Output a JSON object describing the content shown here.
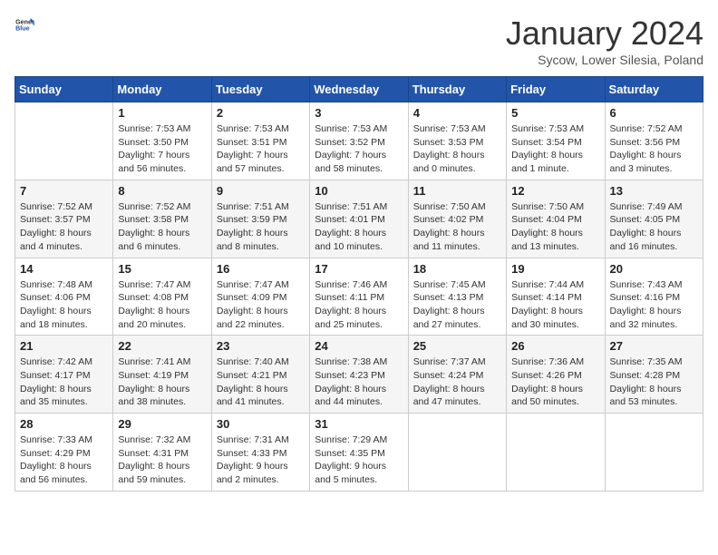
{
  "logo": {
    "general": "General",
    "blue": "Blue"
  },
  "header": {
    "month": "January 2024",
    "location": "Sycow, Lower Silesia, Poland"
  },
  "days_of_week": [
    "Sunday",
    "Monday",
    "Tuesday",
    "Wednesday",
    "Thursday",
    "Friday",
    "Saturday"
  ],
  "weeks": [
    [
      {
        "day": "",
        "info": ""
      },
      {
        "day": "1",
        "info": "Sunrise: 7:53 AM\nSunset: 3:50 PM\nDaylight: 7 hours\nand 56 minutes."
      },
      {
        "day": "2",
        "info": "Sunrise: 7:53 AM\nSunset: 3:51 PM\nDaylight: 7 hours\nand 57 minutes."
      },
      {
        "day": "3",
        "info": "Sunrise: 7:53 AM\nSunset: 3:52 PM\nDaylight: 7 hours\nand 58 minutes."
      },
      {
        "day": "4",
        "info": "Sunrise: 7:53 AM\nSunset: 3:53 PM\nDaylight: 8 hours\nand 0 minutes."
      },
      {
        "day": "5",
        "info": "Sunrise: 7:53 AM\nSunset: 3:54 PM\nDaylight: 8 hours\nand 1 minute."
      },
      {
        "day": "6",
        "info": "Sunrise: 7:52 AM\nSunset: 3:56 PM\nDaylight: 8 hours\nand 3 minutes."
      }
    ],
    [
      {
        "day": "7",
        "info": "Sunrise: 7:52 AM\nSunset: 3:57 PM\nDaylight: 8 hours\nand 4 minutes."
      },
      {
        "day": "8",
        "info": "Sunrise: 7:52 AM\nSunset: 3:58 PM\nDaylight: 8 hours\nand 6 minutes."
      },
      {
        "day": "9",
        "info": "Sunrise: 7:51 AM\nSunset: 3:59 PM\nDaylight: 8 hours\nand 8 minutes."
      },
      {
        "day": "10",
        "info": "Sunrise: 7:51 AM\nSunset: 4:01 PM\nDaylight: 8 hours\nand 10 minutes."
      },
      {
        "day": "11",
        "info": "Sunrise: 7:50 AM\nSunset: 4:02 PM\nDaylight: 8 hours\nand 11 minutes."
      },
      {
        "day": "12",
        "info": "Sunrise: 7:50 AM\nSunset: 4:04 PM\nDaylight: 8 hours\nand 13 minutes."
      },
      {
        "day": "13",
        "info": "Sunrise: 7:49 AM\nSunset: 4:05 PM\nDaylight: 8 hours\nand 16 minutes."
      }
    ],
    [
      {
        "day": "14",
        "info": "Sunrise: 7:48 AM\nSunset: 4:06 PM\nDaylight: 8 hours\nand 18 minutes."
      },
      {
        "day": "15",
        "info": "Sunrise: 7:47 AM\nSunset: 4:08 PM\nDaylight: 8 hours\nand 20 minutes."
      },
      {
        "day": "16",
        "info": "Sunrise: 7:47 AM\nSunset: 4:09 PM\nDaylight: 8 hours\nand 22 minutes."
      },
      {
        "day": "17",
        "info": "Sunrise: 7:46 AM\nSunset: 4:11 PM\nDaylight: 8 hours\nand 25 minutes."
      },
      {
        "day": "18",
        "info": "Sunrise: 7:45 AM\nSunset: 4:13 PM\nDaylight: 8 hours\nand 27 minutes."
      },
      {
        "day": "19",
        "info": "Sunrise: 7:44 AM\nSunset: 4:14 PM\nDaylight: 8 hours\nand 30 minutes."
      },
      {
        "day": "20",
        "info": "Sunrise: 7:43 AM\nSunset: 4:16 PM\nDaylight: 8 hours\nand 32 minutes."
      }
    ],
    [
      {
        "day": "21",
        "info": "Sunrise: 7:42 AM\nSunset: 4:17 PM\nDaylight: 8 hours\nand 35 minutes."
      },
      {
        "day": "22",
        "info": "Sunrise: 7:41 AM\nSunset: 4:19 PM\nDaylight: 8 hours\nand 38 minutes."
      },
      {
        "day": "23",
        "info": "Sunrise: 7:40 AM\nSunset: 4:21 PM\nDaylight: 8 hours\nand 41 minutes."
      },
      {
        "day": "24",
        "info": "Sunrise: 7:38 AM\nSunset: 4:23 PM\nDaylight: 8 hours\nand 44 minutes."
      },
      {
        "day": "25",
        "info": "Sunrise: 7:37 AM\nSunset: 4:24 PM\nDaylight: 8 hours\nand 47 minutes."
      },
      {
        "day": "26",
        "info": "Sunrise: 7:36 AM\nSunset: 4:26 PM\nDaylight: 8 hours\nand 50 minutes."
      },
      {
        "day": "27",
        "info": "Sunrise: 7:35 AM\nSunset: 4:28 PM\nDaylight: 8 hours\nand 53 minutes."
      }
    ],
    [
      {
        "day": "28",
        "info": "Sunrise: 7:33 AM\nSunset: 4:29 PM\nDaylight: 8 hours\nand 56 minutes."
      },
      {
        "day": "29",
        "info": "Sunrise: 7:32 AM\nSunset: 4:31 PM\nDaylight: 8 hours\nand 59 minutes."
      },
      {
        "day": "30",
        "info": "Sunrise: 7:31 AM\nSunset: 4:33 PM\nDaylight: 9 hours\nand 2 minutes."
      },
      {
        "day": "31",
        "info": "Sunrise: 7:29 AM\nSunset: 4:35 PM\nDaylight: 9 hours\nand 5 minutes."
      },
      {
        "day": "",
        "info": ""
      },
      {
        "day": "",
        "info": ""
      },
      {
        "day": "",
        "info": ""
      }
    ]
  ]
}
